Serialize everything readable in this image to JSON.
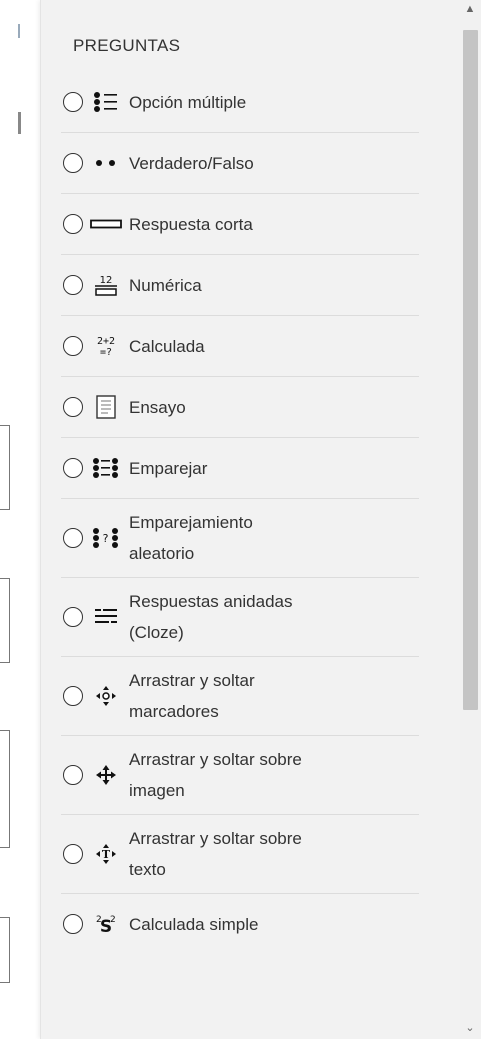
{
  "panel": {
    "title": "PREGUNTAS",
    "items": [
      {
        "label": "Opción múltiple",
        "icon": "multichoice-icon"
      },
      {
        "label": "Verdadero/Falso",
        "icon": "truefalse-icon"
      },
      {
        "label": "Respuesta corta",
        "icon": "shortanswer-icon"
      },
      {
        "label": "Numérica",
        "icon": "numerical-icon"
      },
      {
        "label": "Calculada",
        "icon": "calculated-icon"
      },
      {
        "label": "Ensayo",
        "icon": "essay-icon"
      },
      {
        "label": "Emparejar",
        "icon": "match-icon"
      },
      {
        "label_line1": "Emparejamiento",
        "label_line2": "aleatorio",
        "icon": "randomsamatch-icon"
      },
      {
        "label_line1": "Respuestas anidadas",
        "label_line2": "(Cloze)",
        "icon": "multianswer-icon"
      },
      {
        "label_line1": "Arrastrar y soltar",
        "label_line2": "marcadores",
        "icon": "ddmarker-icon"
      },
      {
        "label_line1": "Arrastrar y soltar sobre",
        "label_line2": "imagen",
        "icon": "ddimageortext-icon"
      },
      {
        "label_line1": "Arrastrar y soltar sobre",
        "label_line2": "texto",
        "icon": "ddwtos-icon"
      },
      {
        "label": "Calculada simple",
        "icon": "calculatedsimple-icon"
      }
    ]
  },
  "icon_text": {
    "numerical": "12",
    "calc_top": "2+2",
    "calc_bottom": "=?",
    "simple_top": "2",
    "simple_sup": "2"
  },
  "colors": {
    "panel_bg": "#f2f2f2",
    "divider": "#dcdcdc",
    "text": "#333333",
    "scroll_thumb": "#c4c4c4"
  }
}
